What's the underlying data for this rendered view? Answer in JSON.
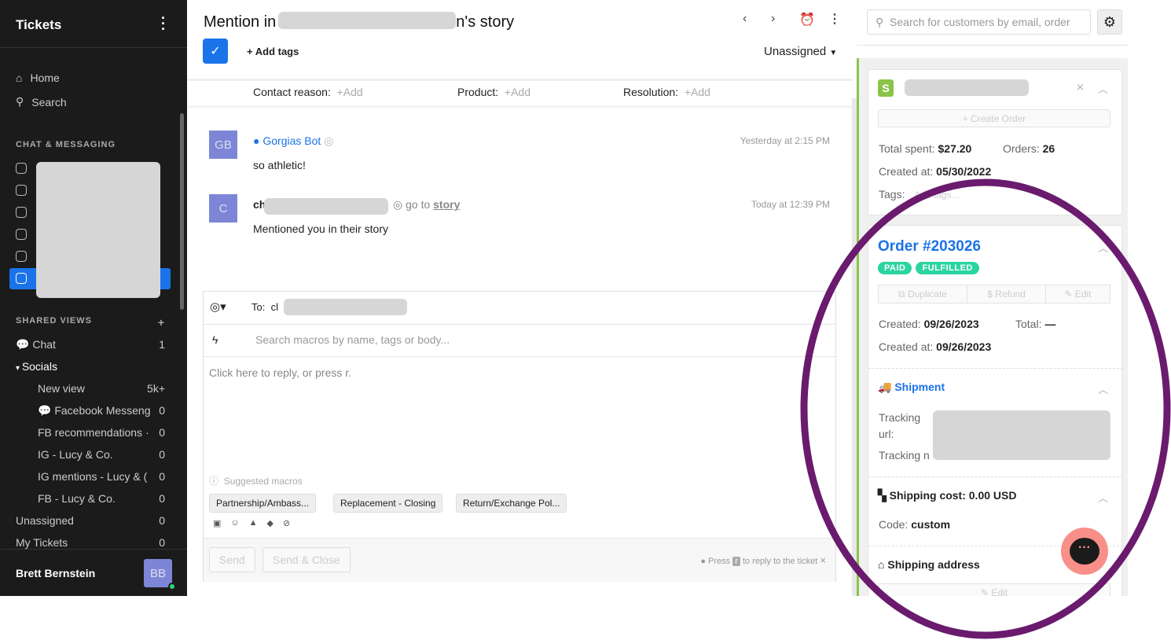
{
  "sidebar": {
    "title": "Tickets",
    "nav": [
      {
        "label": "Home",
        "icon": "home-icon"
      },
      {
        "label": "Search",
        "icon": "search-icon"
      }
    ],
    "chat_section": "CHAT & MESSAGING",
    "shared_views_section": "SHARED VIEWS",
    "views": [
      {
        "label": "Chat",
        "count": "1"
      },
      {
        "label": "Socials",
        "count": ""
      },
      {
        "label": "New view",
        "count": "5k+"
      },
      {
        "label": "Facebook Messeng",
        "count": "0"
      },
      {
        "label": "FB recommendations ·",
        "count": "0"
      },
      {
        "label": "IG - Lucy & Co.",
        "count": "0"
      },
      {
        "label": "IG mentions - Lucy & (",
        "count": "0"
      },
      {
        "label": "FB - Lucy & Co.",
        "count": "0"
      },
      {
        "label": "Unassigned",
        "count": "0"
      },
      {
        "label": "My Tickets",
        "count": "0"
      }
    ],
    "user": {
      "name": "Brett Bernstein",
      "initials": "BB"
    }
  },
  "ticket": {
    "title_prefix": "Mention in",
    "title_suffix": "n's story",
    "add_tags": "Add tags",
    "assignee": "Unassigned",
    "fields": [
      {
        "label": "Contact reason:",
        "value": "+Add"
      },
      {
        "label": "Product:",
        "value": "+Add"
      },
      {
        "label": "Resolution:",
        "value": "+Add"
      }
    ],
    "messages": [
      {
        "initials": "GB",
        "author": "Gorgias Bot",
        "time": "Yesterday at 2:15 PM",
        "body": "so athletic!"
      },
      {
        "initials": "C",
        "author": "ch",
        "link_prefix": "go to",
        "link": "story",
        "time": "Today at 12:39 PM",
        "body": "Mentioned you in their story"
      }
    ]
  },
  "composer": {
    "to_label": "To:",
    "to_value": "cl",
    "macro_placeholder": "Search macros by name, tags or body...",
    "reply_placeholder": "Click here to reply, or press r.",
    "suggested": "Suggested macros",
    "macros": [
      "Partnership/Ambass...",
      "Replacement - Closing",
      "Return/Exchange Pol..."
    ],
    "send": "Send",
    "send_close": "Send & Close",
    "hint_pre": "Press",
    "hint_key": "r",
    "hint_post": "to reply to the ticket"
  },
  "customer": {
    "search_placeholder": "Search for customers by email, order",
    "create_order": "+ Create Order",
    "total_spent_label": "Total spent:",
    "total_spent": "$27.20",
    "orders_label": "Orders:",
    "orders": "26",
    "created_label": "Created at:",
    "created": "05/30/2022",
    "tags_label": "Tags:",
    "tags_placeholder": "Add tags..."
  },
  "order": {
    "title": "Order #203026",
    "badges": [
      "PAID",
      "FULFILLED"
    ],
    "actions": [
      "Duplicate",
      "$ Refund",
      "Edit"
    ],
    "created_label": "Created:",
    "created": "09/26/2023",
    "total_label": "Total:",
    "total": "—",
    "created_at_label": "Created at:",
    "created_at": "09/26/2023",
    "shipment": "Shipment",
    "tracking_url_label": "Tracking url:",
    "tracking_num_label": "Tracking n",
    "shipping_cost": "Shipping cost: 0.00 USD",
    "code_label": "Code:",
    "code": "custom",
    "shipping_address": "Shipping address",
    "edit": "Edit"
  },
  "colors": {
    "accent": "#1a73e8",
    "annotation": "#6a1b6e",
    "badge": "#2bd4a0"
  }
}
